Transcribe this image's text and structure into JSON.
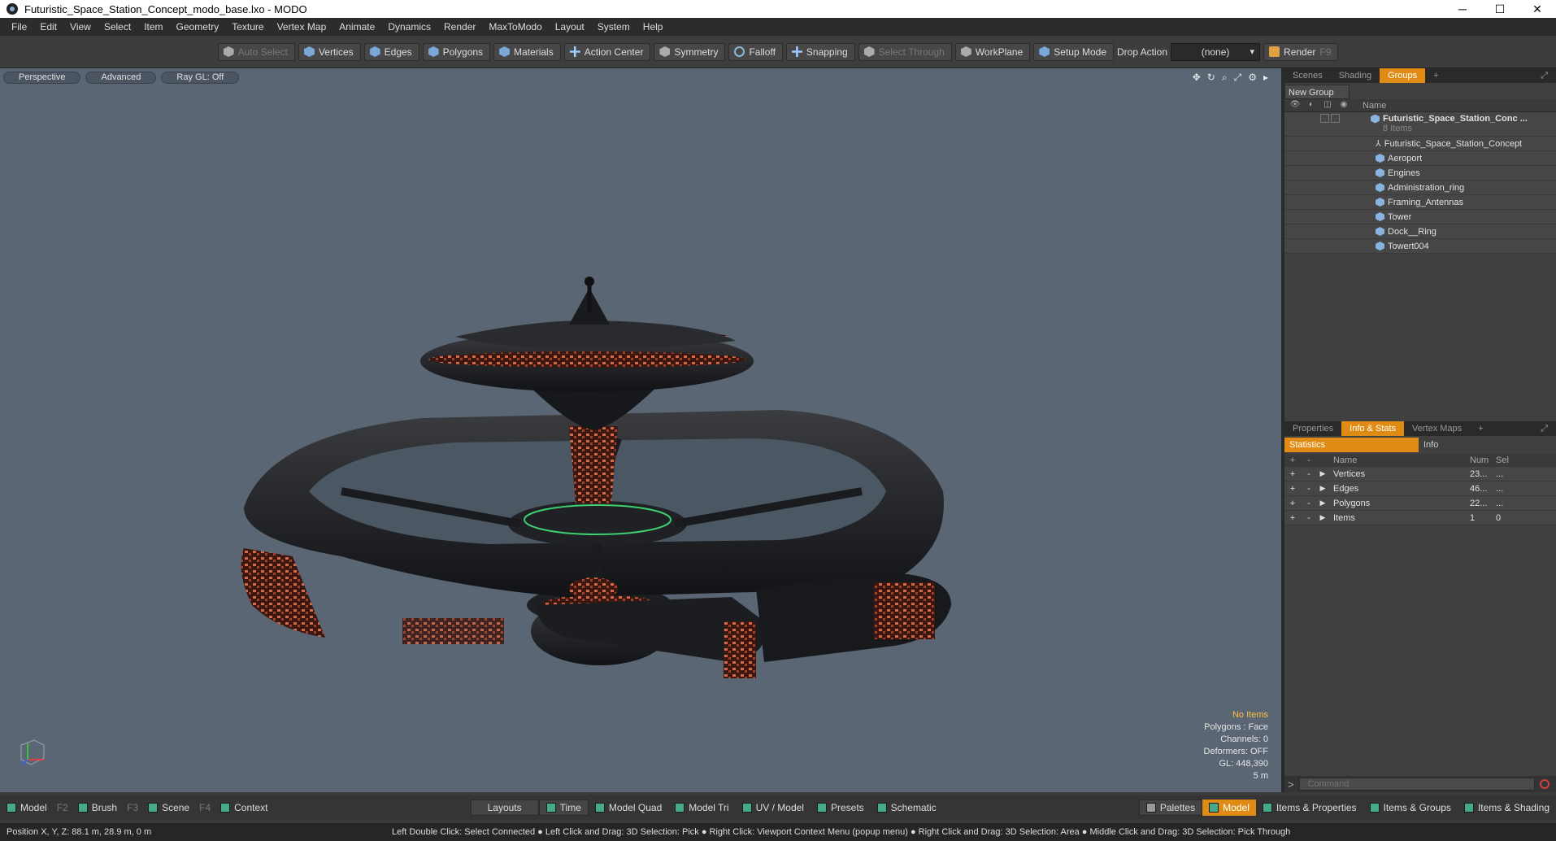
{
  "window": {
    "title": "Futuristic_Space_Station_Concept_modo_base.lxo - MODO",
    "controls": [
      "─",
      "☐",
      "✕"
    ]
  },
  "menu": [
    "File",
    "Edit",
    "View",
    "Select",
    "Item",
    "Geometry",
    "Texture",
    "Vertex Map",
    "Animate",
    "Dynamics",
    "Render",
    "MaxToModo",
    "Layout",
    "System",
    "Help"
  ],
  "toolbar": {
    "auto_select": "Auto Select",
    "vertices": "Vertices",
    "edges": "Edges",
    "polygons": "Polygons",
    "materials": "Materials",
    "action_center": "Action Center",
    "symmetry": "Symmetry",
    "falloff": "Falloff",
    "snapping": "Snapping",
    "select_through": "Select Through",
    "workplane": "WorkPlane",
    "setup_mode": "Setup Mode",
    "drop_action_label": "Drop Action",
    "drop_action_value": "(none)",
    "render": "Render",
    "render_key": "F9"
  },
  "viewport": {
    "perspective": "Perspective",
    "advanced": "Advanced",
    "raygl": "Ray GL: Off",
    "stats": {
      "no_items": "No Items",
      "polygons": "Polygons : Face",
      "channels": "Channels: 0",
      "deformers": "Deformers: OFF",
      "gl": "GL: 448,390",
      "scale": "5 m"
    }
  },
  "groups_panel": {
    "tabs": [
      "Scenes",
      "Shading",
      "Groups"
    ],
    "active_tab": "Groups",
    "new_group": "New Group",
    "col_name": "Name",
    "root": {
      "name": "Futuristic_Space_Station_Conc ...",
      "count": "8 Items"
    },
    "items": [
      "Futuristic_Space_Station_Concept",
      "Aeroport",
      "Engines",
      "Administration_ring",
      "Framing_Antennas",
      "Tower",
      "Dock__Ring",
      "Towert004"
    ]
  },
  "info_panel": {
    "tabs": [
      "Properties",
      "Info & Stats",
      "Vertex Maps"
    ],
    "active_tab": "Info & Stats",
    "statistics": "Statistics",
    "info": "Info",
    "cols": {
      "name": "Name",
      "num": "Num",
      "sel": "Sel"
    },
    "rows": [
      {
        "name": "Vertices",
        "num": "23...",
        "sel": "..."
      },
      {
        "name": "Edges",
        "num": "46...",
        "sel": "..."
      },
      {
        "name": "Polygons",
        "num": "22...",
        "sel": "..."
      },
      {
        "name": "Items",
        "num": "1",
        "sel": "0"
      }
    ],
    "command_placeholder": "Command"
  },
  "bottom": {
    "model": "Model",
    "f2": "F2",
    "brush": "Brush",
    "f3": "F3",
    "scene": "Scene",
    "f4": "F4",
    "context": "Context",
    "layouts": "Layouts",
    "time": "Time",
    "model_quad": "Model Quad",
    "model_tri": "Model Tri",
    "uv_model": "UV / Model",
    "presets": "Presets",
    "schematic": "Schematic",
    "palettes": "Palettes",
    "model_active": "Model",
    "items_properties": "Items & Properties",
    "items_groups": "Items & Groups",
    "items_shading": "Items & Shading"
  },
  "status": {
    "position": "Position X, Y, Z:   88.1 m, 28.9 m, 0 m",
    "hint": "Left Double Click: Select Connected ● Left Click and Drag: 3D Selection: Pick ● Right Click: Viewport Context Menu (popup menu) ● Right Click and Drag: 3D Selection: Area ● Middle Click and Drag: 3D Selection: Pick Through"
  },
  "colors": {
    "accent": "#e08c14",
    "viewport_bg": "#5a6674",
    "stat_highlight": "#ffc040"
  }
}
